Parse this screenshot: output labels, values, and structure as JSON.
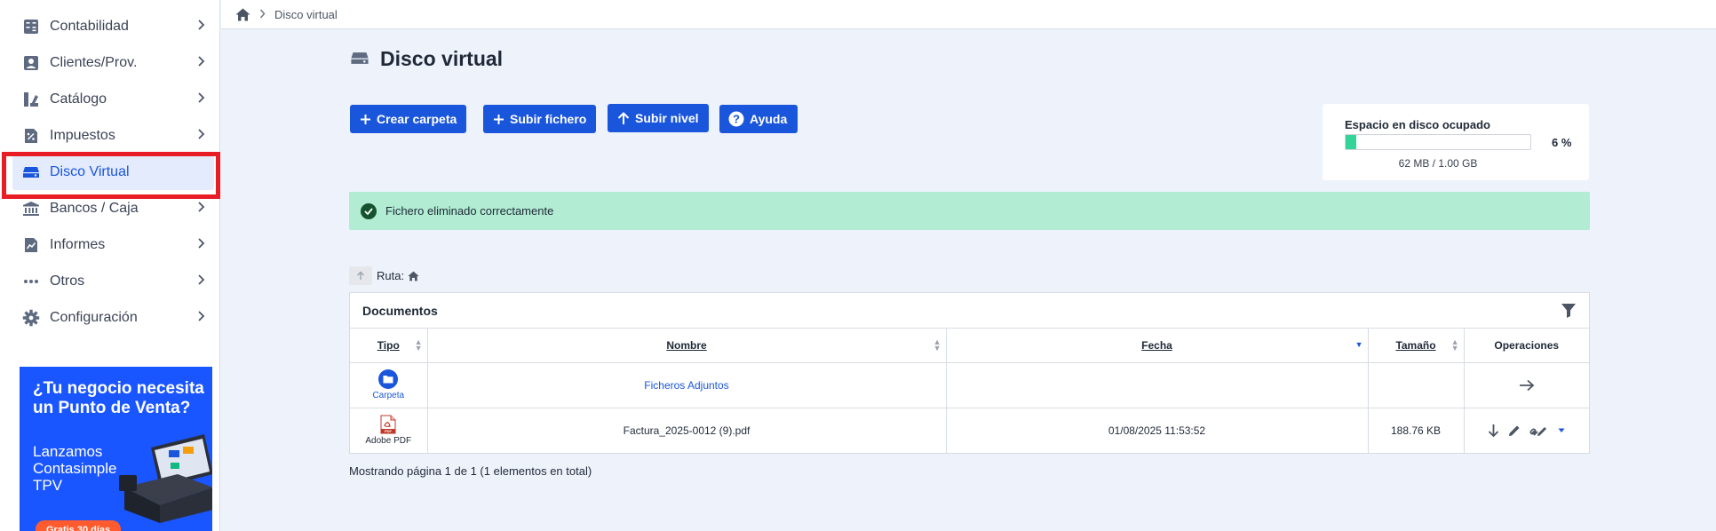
{
  "sidebar": {
    "items": [
      {
        "label": "Contabilidad",
        "icon": "ledger-icon"
      },
      {
        "label": "Clientes/Prov.",
        "icon": "contact-icon"
      },
      {
        "label": "Catálogo",
        "icon": "catalog-icon"
      },
      {
        "label": "Impuestos",
        "icon": "tax-icon"
      },
      {
        "label": "Disco Virtual",
        "icon": "disk-icon",
        "active": true
      },
      {
        "label": "Bancos / Caja",
        "icon": "bank-icon"
      },
      {
        "label": "Informes",
        "icon": "report-icon"
      },
      {
        "label": "Otros",
        "icon": "dots-icon"
      },
      {
        "label": "Configuración",
        "icon": "gear-icon"
      }
    ],
    "promo": {
      "headline": "¿Tu negocio necesita un Punto de Venta?",
      "body": "Lanzamos Contasimple TPV",
      "cta": "Gratis 30 días"
    }
  },
  "breadcrumb": {
    "current": "Disco virtual"
  },
  "page": {
    "title": "Disco virtual"
  },
  "toolbar": {
    "create_folder": "Crear carpeta",
    "upload_file": "Subir fichero",
    "up_level": "Subir nivel",
    "help": "Ayuda"
  },
  "disk": {
    "label": "Espacio en disco ocupado",
    "percent": 6,
    "percent_label": "6 %",
    "used_label": "62 MB / 1.00 GB",
    "fill_color": "#34d399"
  },
  "alert": {
    "message": "Fichero eliminado correctamente"
  },
  "path": {
    "label": "Ruta:"
  },
  "documents": {
    "title": "Documentos",
    "columns": {
      "tipo": "Tipo",
      "nombre": "Nombre",
      "fecha": "Fecha",
      "tamano": "Tamaño",
      "operaciones": "Operaciones"
    },
    "rows": [
      {
        "type": "Carpeta",
        "name": "Ficheros Adjuntos",
        "date": "",
        "size": ""
      },
      {
        "type": "Adobe PDF",
        "name": "Factura_2025-0012 (9).pdf",
        "date": "01/08/2025 11:53:52",
        "size": "188.76 KB"
      }
    ],
    "pager": "Mostrando página 1 de 1 (1 elementos en total)"
  },
  "colors": {
    "primary": "#1a56db",
    "alert_bg": "#b1ecd3",
    "highlight": "#e81c24"
  }
}
